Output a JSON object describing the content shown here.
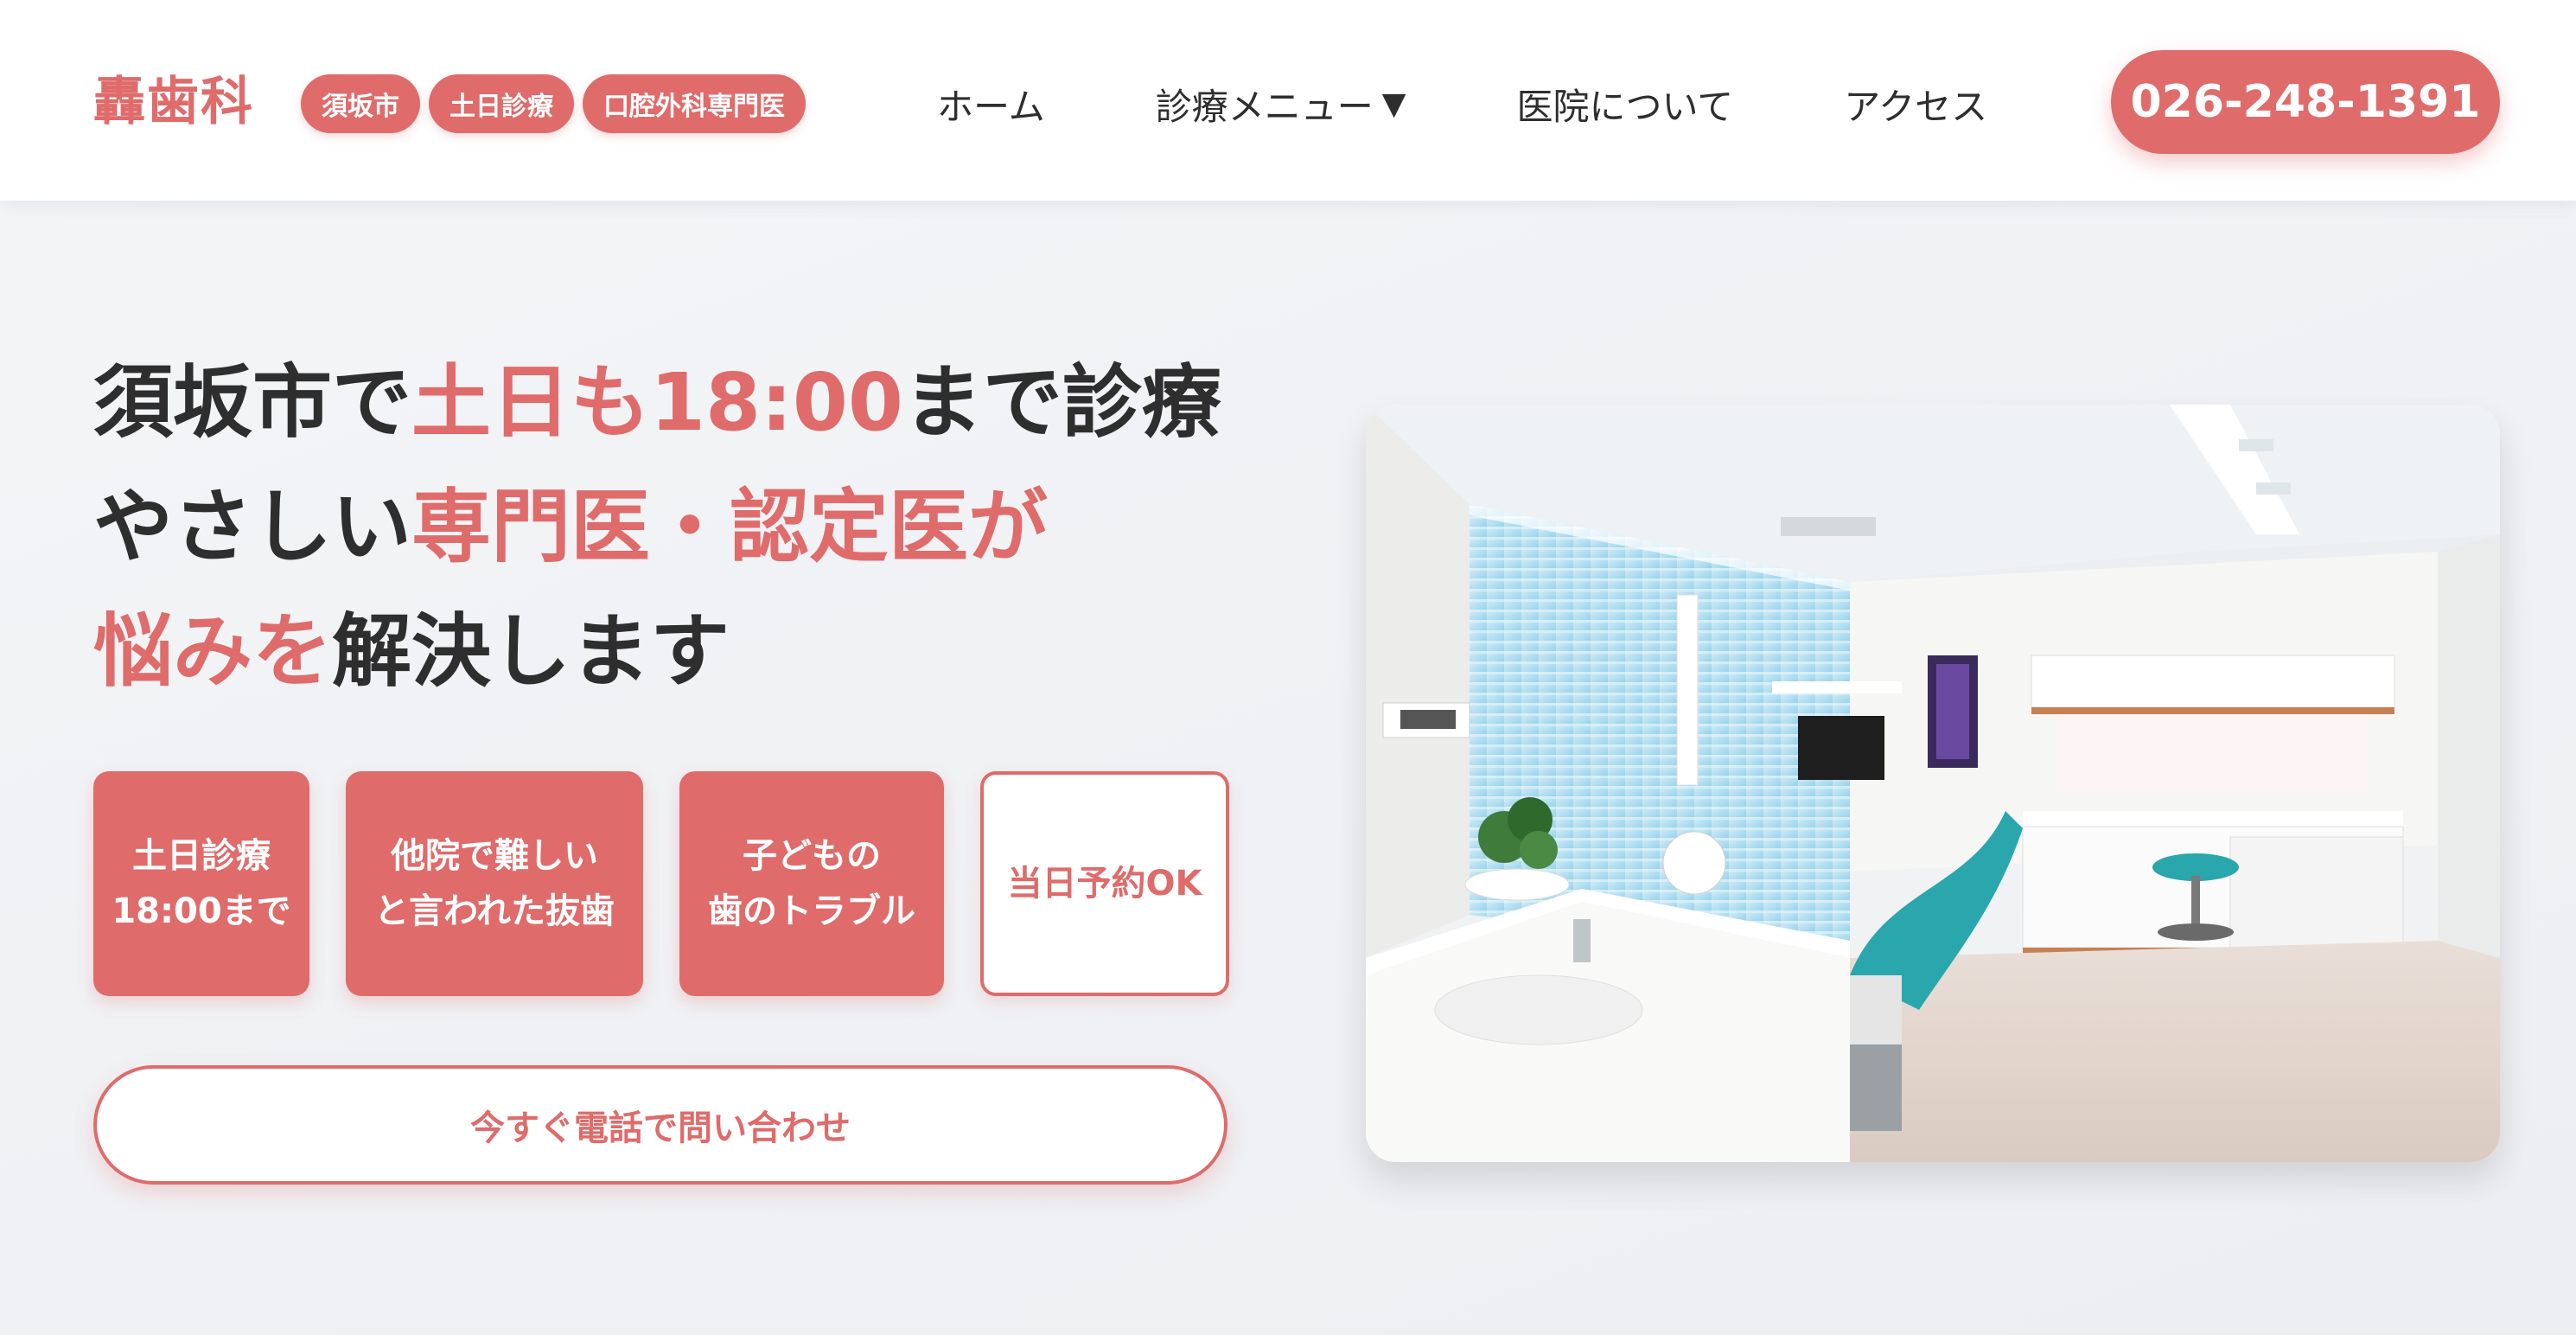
{
  "header": {
    "logo": "轟歯科",
    "tags": [
      "須坂市",
      "土日診療",
      "口腔外科専門医"
    ],
    "nav": [
      {
        "label": "ホーム"
      },
      {
        "label": "診療メニュー",
        "caret": "▼"
      },
      {
        "label": "医院について"
      },
      {
        "label": "アクセス"
      }
    ],
    "phone": "026-248-1391"
  },
  "hero": {
    "headline": {
      "line1": [
        "須坂市で",
        "土日も18:00",
        "まで診療"
      ],
      "line2": [
        "やさしい",
        "専門医・認定医が"
      ],
      "line3": [
        "悩みを",
        "解決します"
      ]
    },
    "features": [
      {
        "line1": "土日診療",
        "line2": "18:00まで"
      },
      {
        "line1": "他院で難しい",
        "line2": "と言われた抜歯"
      },
      {
        "line1": "子どもの",
        "line2": "歯のトラブル"
      },
      {
        "line1": "当日予約OK"
      }
    ],
    "cta": "今すぐ電話で問い合わせ"
  },
  "image": {
    "icon": "dental-clinic-room-photo"
  },
  "colors": {
    "accent": "#df6b6b",
    "text": "#2e2e2e",
    "background": "#f1f2f4",
    "header": "#ffffff"
  }
}
